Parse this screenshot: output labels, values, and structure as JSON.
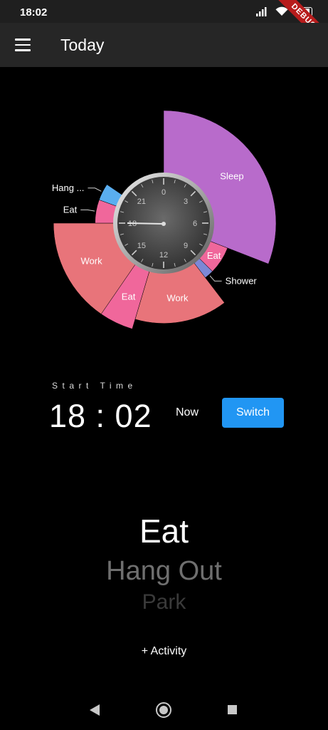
{
  "status_bar": {
    "time": "18:02",
    "battery": "80",
    "debug_banner": "DEBUG"
  },
  "app_bar": {
    "title": "Today",
    "menu_icon": "hamburger-menu-icon"
  },
  "chart_data": {
    "type": "pie",
    "start_angle_deg": 0,
    "direction": "clockwise",
    "center_clock_ticks": [
      "0",
      "3",
      "6",
      "9",
      "12",
      "15",
      "18",
      "21"
    ],
    "slices": [
      {
        "label": "Sleep",
        "fraction": 0.309,
        "radius": 1.0,
        "color": "#b86bcb",
        "label_position": "inside"
      },
      {
        "label": "Eat",
        "fraction": 0.065,
        "radius": 0.61,
        "color": "#f0679b",
        "label_position": "inside"
      },
      {
        "label": "Shower",
        "fraction": 0.022,
        "radius": 0.61,
        "color": "#7d88d6",
        "label_position": "outside"
      },
      {
        "label": "Work",
        "fraction": 0.15,
        "radius": 0.89,
        "color": "#e8747a",
        "label_position": "inside"
      },
      {
        "label": "Eat",
        "fraction": 0.05,
        "radius": 0.98,
        "color": "#f0679b",
        "label_position": "inside"
      },
      {
        "label": "Work",
        "fraction": 0.154,
        "radius": 0.98,
        "color": "#e8747a",
        "label_position": "inside"
      },
      {
        "label": "Eat",
        "fraction": 0.055,
        "radius": 0.61,
        "color": "#f0679b",
        "label_position": "outside"
      },
      {
        "label": "Hang ...",
        "fraction": 0.04,
        "radius": 0.61,
        "color": "#5aaef0",
        "label_position": "outside"
      }
    ]
  },
  "start_time": {
    "label": "Start Time",
    "value": "18 : 02"
  },
  "buttons": {
    "now": "Now",
    "switch": "Switch"
  },
  "activity_picker": {
    "items": [
      "Eat",
      "Hang Out",
      "Park"
    ]
  },
  "add_activity": "+ Activity",
  "nav_bar": {
    "back_icon": "back-triangle-icon",
    "home_icon": "home-circle-icon",
    "recent_icon": "recent-square-icon"
  }
}
